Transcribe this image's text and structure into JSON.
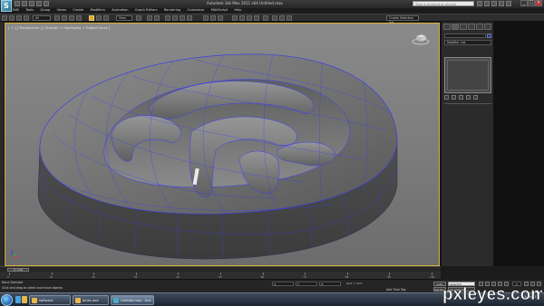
{
  "titlebar": {
    "app_letter": "S",
    "title": "Autodesk 3ds Max 2011 x64    Untitled.max",
    "search_placeholder": "Type a keyword or phrase"
  },
  "menubar": {
    "items": [
      "Edit",
      "Tools",
      "Group",
      "Views",
      "Create",
      "Modifiers",
      "Animation",
      "Graph Editors",
      "Rendering",
      "Customize",
      "MAXScript",
      "Help"
    ]
  },
  "toolbar": {
    "filter_value": "All",
    "view_value": "View",
    "selection_set": "Create Selection Set"
  },
  "viewport": {
    "label": "[ + ] [ Perspective ] [ Smooth + Highlights + Edged Faces ]",
    "wire_color": "#3a3aff",
    "frame_color": "#d9b13a"
  },
  "command_panel": {
    "modifier_list": "Modifier List"
  },
  "timeline": {
    "slider": "0 / 100",
    "ticks": [
      "0",
      "10",
      "20",
      "30",
      "40",
      "50",
      "60",
      "70",
      "80",
      "90",
      "100"
    ]
  },
  "statusbar": {
    "line1": "None Selected",
    "line2": "Click and drag to select and move objects",
    "x_label": "X:",
    "y_label": "Y:",
    "z_label": "Z:",
    "grid": "Grid = 10.0",
    "add_time_tag": "Add Time Tag",
    "auto_key": "Auto Key",
    "set_key": "Set Key",
    "key_mode": "Selected",
    "key_filters": "Key Filters...",
    "frame": "0"
  },
  "taskbar": {
    "buttons": [
      "software",
      "jones pud",
      "Untitled.max - Aut..."
    ],
    "clock": "16 Nov 11"
  },
  "watermark": {
    "text": "pxleyes.com"
  }
}
